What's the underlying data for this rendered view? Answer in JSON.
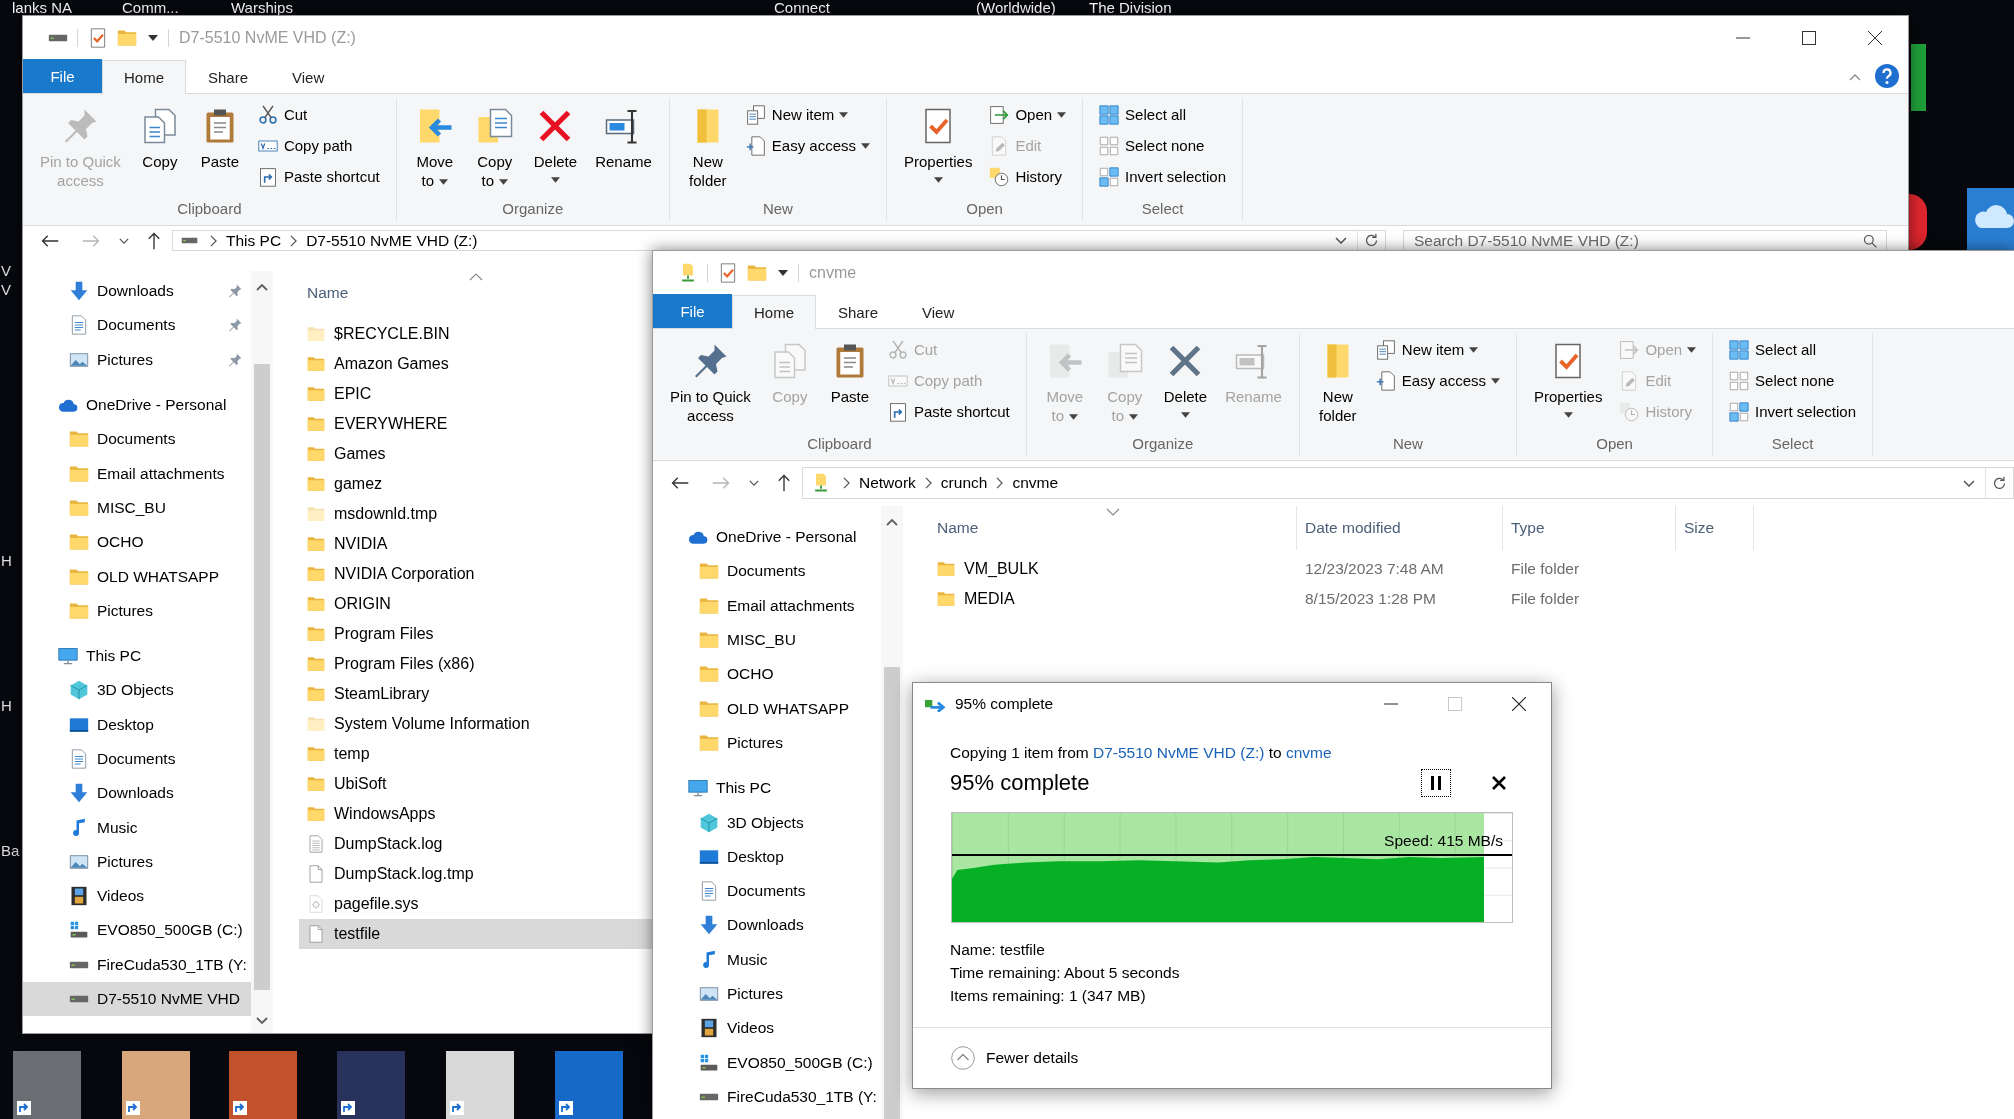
{
  "desktop": {
    "top_labels": [
      "lanks NA",
      "Comm...",
      "Warships",
      "Connect",
      "(Worldwide)",
      "The Division"
    ],
    "edge_labels": [
      "V",
      "V",
      "H",
      "H",
      "Ba"
    ]
  },
  "windows": [
    {
      "kind": "drive",
      "title": "D7-5510 NvME VHD (Z:)",
      "window_controls": true,
      "tabs": [
        {
          "label": "File",
          "kind": "file",
          "selected": false
        },
        {
          "label": "Home",
          "kind": "tab",
          "selected": true
        },
        {
          "label": "Share",
          "kind": "tab",
          "selected": false
        },
        {
          "label": "View",
          "kind": "tab",
          "selected": false
        }
      ],
      "ribbon": [
        {
          "label": "Clipboard",
          "large": [
            {
              "label": "Pin to Quick access",
              "kind": "pin",
              "disabled": true,
              "dropdown": false
            },
            {
              "label": "Copy",
              "kind": "copy",
              "disabled": false,
              "dropdown": false
            },
            {
              "label": "Paste",
              "kind": "paste",
              "disabled": false,
              "dropdown": false
            }
          ],
          "small": [
            {
              "label": "Cut",
              "kind": "cut",
              "disabled": false,
              "dropdown": false
            },
            {
              "label": "Copy path",
              "kind": "copy-path",
              "disabled": false,
              "dropdown": false
            },
            {
              "label": "Paste shortcut",
              "kind": "paste-shortcut",
              "disabled": false,
              "dropdown": false
            }
          ]
        },
        {
          "label": "Organize",
          "large": [
            {
              "label": "Move to",
              "kind": "move-to",
              "disabled": false,
              "dropdown": true
            },
            {
              "label": "Copy to",
              "kind": "copy-to",
              "disabled": false,
              "dropdown": true
            },
            {
              "label": "Delete",
              "kind": "delete",
              "disabled": false,
              "dropdown": true
            },
            {
              "label": "Rename",
              "kind": "rename",
              "disabled": false,
              "dropdown": false
            }
          ]
        },
        {
          "label": "New",
          "large": [
            {
              "label": "New folder",
              "kind": "new-folder",
              "disabled": false,
              "dropdown": false
            }
          ],
          "small": [
            {
              "label": "New item",
              "kind": "new-item",
              "disabled": false,
              "dropdown": true
            },
            {
              "label": "Easy access",
              "kind": "easy-access",
              "disabled": false,
              "dropdown": true
            }
          ]
        },
        {
          "label": "Open",
          "large": [
            {
              "label": "Properties",
              "kind": "properties",
              "disabled": false,
              "dropdown": true
            }
          ],
          "small": [
            {
              "label": "Open",
              "kind": "open",
              "disabled": false,
              "dropdown": true
            },
            {
              "label": "Edit",
              "kind": "edit",
              "disabled": true,
              "dropdown": false
            },
            {
              "label": "History",
              "kind": "history",
              "disabled": false,
              "dropdown": false
            }
          ]
        },
        {
          "label": "Select",
          "small": [
            {
              "label": "Select all",
              "kind": "select-all",
              "disabled": false,
              "dropdown": false
            },
            {
              "label": "Select none",
              "kind": "select-none",
              "disabled": false,
              "dropdown": false
            },
            {
              "label": "Invert selection",
              "kind": "invert",
              "disabled": false,
              "dropdown": false
            }
          ]
        }
      ],
      "address": {
        "path": [
          "This PC",
          "D7-5510 NvME VHD (Z:)"
        ]
      },
      "search": {
        "placeholder": "Search D7-5510 NvME VHD (Z:)"
      },
      "quick_access": [
        {
          "label": "Downloads",
          "kind": "downloads",
          "pinned": true,
          "selected": false
        },
        {
          "label": "Documents",
          "kind": "documents",
          "pinned": true,
          "selected": false
        },
        {
          "label": "Pictures",
          "kind": "pictures",
          "pinned": true,
          "selected": false
        }
      ],
      "nav": [
        {
          "label": "OneDrive - Personal",
          "kind": "onedrive",
          "selected": false,
          "children": [
            {
              "label": "Documents",
              "kind": "folder",
              "selected": false
            },
            {
              "label": "Email attachments",
              "kind": "folder",
              "selected": false
            },
            {
              "label": "MISC_BU",
              "kind": "folder",
              "selected": false
            },
            {
              "label": "OCHO",
              "kind": "folder",
              "selected": false
            },
            {
              "label": "OLD WHATSAPP",
              "kind": "folder",
              "selected": false
            },
            {
              "label": "Pictures",
              "kind": "folder",
              "selected": false
            }
          ]
        },
        {
          "label": "This PC",
          "kind": "pc",
          "selected": false,
          "children": [
            {
              "label": "3D Objects",
              "kind": "objects",
              "selected": false
            },
            {
              "label": "Desktop",
              "kind": "desktop",
              "selected": false
            },
            {
              "label": "Documents",
              "kind": "documents",
              "selected": false
            },
            {
              "label": "Downloads",
              "kind": "downloads",
              "selected": false
            },
            {
              "label": "Music",
              "kind": "music",
              "selected": false
            },
            {
              "label": "Pictures",
              "kind": "pictures",
              "selected": false
            },
            {
              "label": "Videos",
              "kind": "videos",
              "selected": false
            },
            {
              "label": "EVO850_500GB (C:)",
              "kind": "system-drive",
              "selected": false
            },
            {
              "label": "FireCuda530_1TB (Y:",
              "kind": "drive",
              "selected": false
            },
            {
              "label": "D7-5510 NvME VHD",
              "kind": "drive",
              "selected": true
            }
          ]
        }
      ],
      "columns": [
        {
          "label": "Name",
          "sorted": true,
          "ascending": true
        }
      ],
      "files": [
        {
          "name": "$RECYCLE.BIN",
          "kind": "folder",
          "hidden": true,
          "selected": false
        },
        {
          "name": "Amazon Games",
          "kind": "folder",
          "hidden": false,
          "selected": false
        },
        {
          "name": "EPIC",
          "kind": "folder",
          "hidden": false,
          "selected": false
        },
        {
          "name": "EVERYWHERE",
          "kind": "folder",
          "hidden": false,
          "selected": false
        },
        {
          "name": "Games",
          "kind": "folder",
          "hidden": false,
          "selected": false
        },
        {
          "name": "gamez",
          "kind": "folder",
          "hidden": false,
          "selected": false
        },
        {
          "name": "msdownld.tmp",
          "kind": "folder",
          "hidden": true,
          "selected": false
        },
        {
          "name": "NVIDIA",
          "kind": "folder",
          "hidden": false,
          "selected": false
        },
        {
          "name": "NVIDIA Corporation",
          "kind": "folder",
          "hidden": false,
          "selected": false
        },
        {
          "name": "ORIGIN",
          "kind": "folder",
          "hidden": false,
          "selected": false
        },
        {
          "name": "Program Files",
          "kind": "folder",
          "hidden": false,
          "selected": false
        },
        {
          "name": "Program Files (x86)",
          "kind": "folder",
          "hidden": false,
          "selected": false
        },
        {
          "name": "SteamLibrary",
          "kind": "folder",
          "hidden": false,
          "selected": false
        },
        {
          "name": "System Volume Information",
          "kind": "folder",
          "hidden": true,
          "selected": false
        },
        {
          "name": "temp",
          "kind": "folder",
          "hidden": false,
          "selected": false
        },
        {
          "name": "UbiSoft",
          "kind": "folder",
          "hidden": false,
          "selected": false
        },
        {
          "name": "WindowsApps",
          "kind": "folder",
          "hidden": false,
          "selected": false
        },
        {
          "name": "DumpStack.log",
          "kind": "document",
          "hidden": false,
          "selected": false
        },
        {
          "name": "DumpStack.log.tmp",
          "kind": "file",
          "hidden": false,
          "selected": false
        },
        {
          "name": "pagefile.sys",
          "kind": "system",
          "hidden": true,
          "selected": false
        },
        {
          "name": "testfile",
          "kind": "file",
          "hidden": false,
          "selected": true
        }
      ]
    },
    {
      "kind": "network",
      "title": "cnvme",
      "tabs": [
        {
          "label": "File",
          "kind": "file",
          "selected": false
        },
        {
          "label": "Home",
          "kind": "tab",
          "selected": true
        },
        {
          "label": "Share",
          "kind": "tab",
          "selected": false
        },
        {
          "label": "View",
          "kind": "tab",
          "selected": false
        }
      ],
      "ribbon": [
        {
          "label": "Clipboard",
          "large": [
            {
              "label": "Pin to Quick access",
              "kind": "pin",
              "disabled": false,
              "dropdown": false
            },
            {
              "label": "Copy",
              "kind": "copy",
              "disabled": true,
              "dropdown": false
            },
            {
              "label": "Paste",
              "kind": "paste",
              "disabled": false,
              "dropdown": false
            }
          ],
          "small": [
            {
              "label": "Cut",
              "kind": "cut",
              "disabled": true,
              "dropdown": false
            },
            {
              "label": "Copy path",
              "kind": "copy-path",
              "disabled": true,
              "dropdown": false
            },
            {
              "label": "Paste shortcut",
              "kind": "paste-shortcut",
              "disabled": false,
              "dropdown": false
            }
          ]
        },
        {
          "label": "Organize",
          "large": [
            {
              "label": "Move to",
              "kind": "move-to",
              "disabled": true,
              "dropdown": true
            },
            {
              "label": "Copy to",
              "kind": "copy-to",
              "disabled": true,
              "dropdown": true
            },
            {
              "label": "Delete",
              "kind": "delete-permanent",
              "disabled": false,
              "dropdown": true
            },
            {
              "label": "Rename",
              "kind": "rename",
              "disabled": true,
              "dropdown": false
            }
          ]
        },
        {
          "label": "New",
          "large": [
            {
              "label": "New folder",
              "kind": "new-folder",
              "disabled": false,
              "dropdown": false
            }
          ],
          "small": [
            {
              "label": "New item",
              "kind": "new-item",
              "disabled": false,
              "dropdown": true
            },
            {
              "label": "Easy access",
              "kind": "easy-access",
              "disabled": false,
              "dropdown": true
            }
          ]
        },
        {
          "label": "Open",
          "large": [
            {
              "label": "Properties",
              "kind": "properties",
              "disabled": false,
              "dropdown": true
            }
          ],
          "small": [
            {
              "label": "Open",
              "kind": "open",
              "disabled": true,
              "dropdown": true
            },
            {
              "label": "Edit",
              "kind": "edit",
              "disabled": true,
              "dropdown": false
            },
            {
              "label": "History",
              "kind": "history",
              "disabled": true,
              "dropdown": false
            }
          ]
        },
        {
          "label": "Select",
          "small": [
            {
              "label": "Select all",
              "kind": "select-all",
              "disabled": false,
              "dropdown": false
            },
            {
              "label": "Select none",
              "kind": "select-none",
              "disabled": false,
              "dropdown": false
            },
            {
              "label": "Invert selection",
              "kind": "invert",
              "disabled": false,
              "dropdown": false
            }
          ]
        }
      ],
      "address": {
        "path": [
          "Network",
          "crunch",
          "cnvme"
        ]
      },
      "nav": [
        {
          "label": "OneDrive - Personal",
          "kind": "onedrive",
          "selected": false,
          "children": [
            {
              "label": "Documents",
              "kind": "folder",
              "selected": false
            },
            {
              "label": "Email attachments",
              "kind": "folder",
              "selected": false
            },
            {
              "label": "MISC_BU",
              "kind": "folder",
              "selected": false
            },
            {
              "label": "OCHO",
              "kind": "folder",
              "selected": false
            },
            {
              "label": "OLD WHATSAPP",
              "kind": "folder",
              "selected": false
            },
            {
              "label": "Pictures",
              "kind": "folder",
              "selected": false
            }
          ]
        },
        {
          "label": "This PC",
          "kind": "pc",
          "selected": false,
          "children": [
            {
              "label": "3D Objects",
              "kind": "objects",
              "selected": false
            },
            {
              "label": "Desktop",
              "kind": "desktop",
              "selected": false
            },
            {
              "label": "Documents",
              "kind": "documents",
              "selected": false
            },
            {
              "label": "Downloads",
              "kind": "downloads",
              "selected": false
            },
            {
              "label": "Music",
              "kind": "music",
              "selected": false
            },
            {
              "label": "Pictures",
              "kind": "pictures",
              "selected": false
            },
            {
              "label": "Videos",
              "kind": "videos",
              "selected": false
            },
            {
              "label": "EVO850_500GB (C:)",
              "kind": "system-drive",
              "selected": false
            },
            {
              "label": "FireCuda530_1TB (Y:",
              "kind": "drive",
              "selected": false
            }
          ]
        }
      ],
      "columns": [
        {
          "label": "Name",
          "sorted": true,
          "ascending": false
        },
        {
          "label": "Date modified",
          "sorted": false
        },
        {
          "label": "Type",
          "sorted": false
        },
        {
          "label": "Size",
          "sorted": false
        }
      ],
      "files": [
        {
          "name": "VM_BULK",
          "kind": "folder",
          "selected": false,
          "cells": [
            "12/23/2023 7:48 AM",
            "File folder"
          ]
        },
        {
          "name": "MEDIA",
          "kind": "folder",
          "selected": false,
          "cells": [
            "8/15/2023 1:28 PM",
            "File folder"
          ]
        }
      ]
    }
  ],
  "dialog": {
    "title": "95% complete",
    "copying": {
      "prefix": "Copying 1 item from",
      "source": "D7-5510 NvME VHD (Z:)",
      "joiner": "to",
      "destination": "cnvme"
    },
    "heading": "95% complete",
    "paused": false,
    "progress": {
      "level": 0.95,
      "speed": "Speed: 415 MB/s"
    },
    "details": [
      "Name: testfile",
      "Time remaining: About 5 seconds",
      "Items remaining: 1 (347 MB)"
    ],
    "toggle": {
      "label": "Fewer details",
      "expanded": true
    }
  }
}
